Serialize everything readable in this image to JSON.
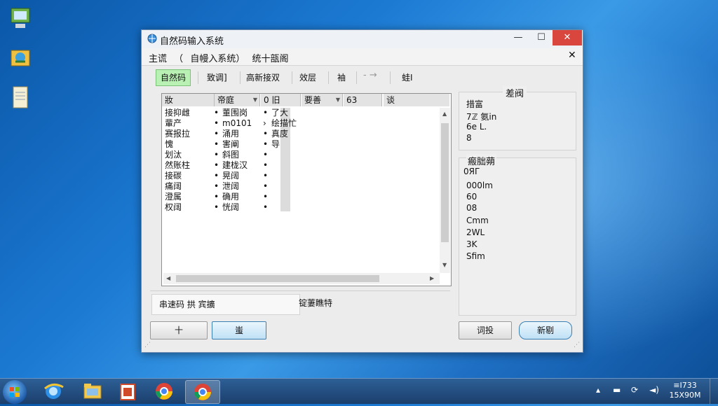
{
  "window": {
    "title": "自然码输入系统",
    "controls": {
      "minimize": "—",
      "maximize": "☐",
      "close": "✕"
    }
  },
  "breadcrumb": [
    "主谎",
    "（",
    "自幔入系统）",
    "统十瓿阁"
  ],
  "inner_close": "✕",
  "toolbar": {
    "items": [
      "自然码",
      "致调]",
      "高新接双",
      "效层",
      "袖",
      "蛙I"
    ],
    "arrow": "- →",
    "active_index": 0
  },
  "list": {
    "columns": [
      "妝",
      "帝庭",
      "0 旧",
      "要善",
      "63",
      "谈"
    ],
    "rows": [
      {
        "c1": "接抑雌",
        "c2": "董围岗",
        "c3": "了大"
      },
      {
        "c1": "輩产",
        "c2": "m0101",
        "c3": "绘描忙"
      },
      {
        "c1": "赛报拉",
        "c2": "涌用",
        "c3": "真庋"
      },
      {
        "c1": "愧",
        "c2": "害阐",
        "c3": "导"
      },
      {
        "c1": "划汰",
        "c2": "斜图",
        "c3": ""
      },
      {
        "c1": "然账柱",
        "c2": "建栊汉",
        "c3": ""
      },
      {
        "c1": "接碳",
        "c2": "晃阔",
        "c3": ""
      },
      {
        "c1": "痛阔",
        "c2": "泄阔",
        "c3": ""
      },
      {
        "c1": "澄属",
        "c2": "确用",
        "c3": ""
      },
      {
        "c1": "权阔",
        "c2": "恍阔",
        "c3": ""
      }
    ],
    "bullet": "•",
    "arrow_bullet": "›"
  },
  "status": {
    "left": "串速码  拱  宾擴",
    "right": "锭萋瞧特"
  },
  "buttons": {
    "left1": "十",
    "left2": "蚩",
    "right1": "词投",
    "right2": "新剔"
  },
  "right_panel": {
    "group1_title": "差阀",
    "group1_lines": [
      "措富",
      "7ℤ 氨in",
      "6e  L.",
      "8"
    ],
    "group2_title": "瘢朏蒴",
    "group2_lines": [
      "0ЯГ",
      "000lm",
      "60",
      "08",
      "Cmm",
      "2WL",
      "3K",
      "Sfim"
    ]
  },
  "taskbar": {
    "clock_time": "≡I733",
    "clock_date": "15X90M"
  },
  "colors": {
    "accent_green": "#b9f0b4",
    "close_red": "#d9463e",
    "desktop_blue": "#1c7ad3"
  }
}
